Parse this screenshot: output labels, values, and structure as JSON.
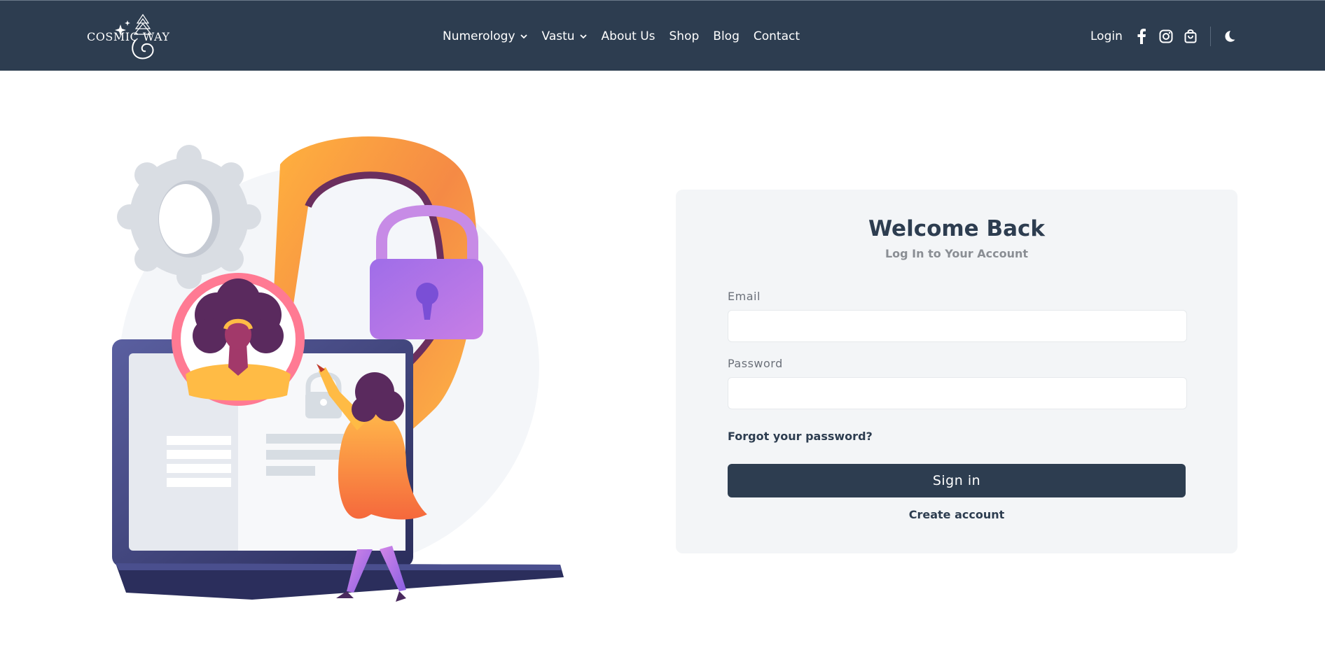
{
  "header": {
    "logo_text": "COSMIC WAY",
    "nav": [
      {
        "label": "Numerology",
        "has_dropdown": true
      },
      {
        "label": "Vastu",
        "has_dropdown": true
      },
      {
        "label": "About Us",
        "has_dropdown": false
      },
      {
        "label": "Shop",
        "has_dropdown": false
      },
      {
        "label": "Blog",
        "has_dropdown": false
      },
      {
        "label": "Contact",
        "has_dropdown": false
      }
    ],
    "login_label": "Login",
    "icons": [
      "facebook-icon",
      "instagram-icon",
      "shopping-bag-icon",
      "moon-icon"
    ]
  },
  "login": {
    "title": "Welcome Back",
    "subtitle": "Log In to Your Account",
    "email_label": "Email",
    "email_value": "",
    "password_label": "Password",
    "password_value": "",
    "forgot_label": "Forgot your password?",
    "signin_label": "Sign in",
    "create_label": "Create account"
  },
  "colors": {
    "header_bg": "#2d3d50",
    "card_bg": "#f3f5f7",
    "primary": "#2d3d50",
    "muted": "#8a8e94"
  }
}
